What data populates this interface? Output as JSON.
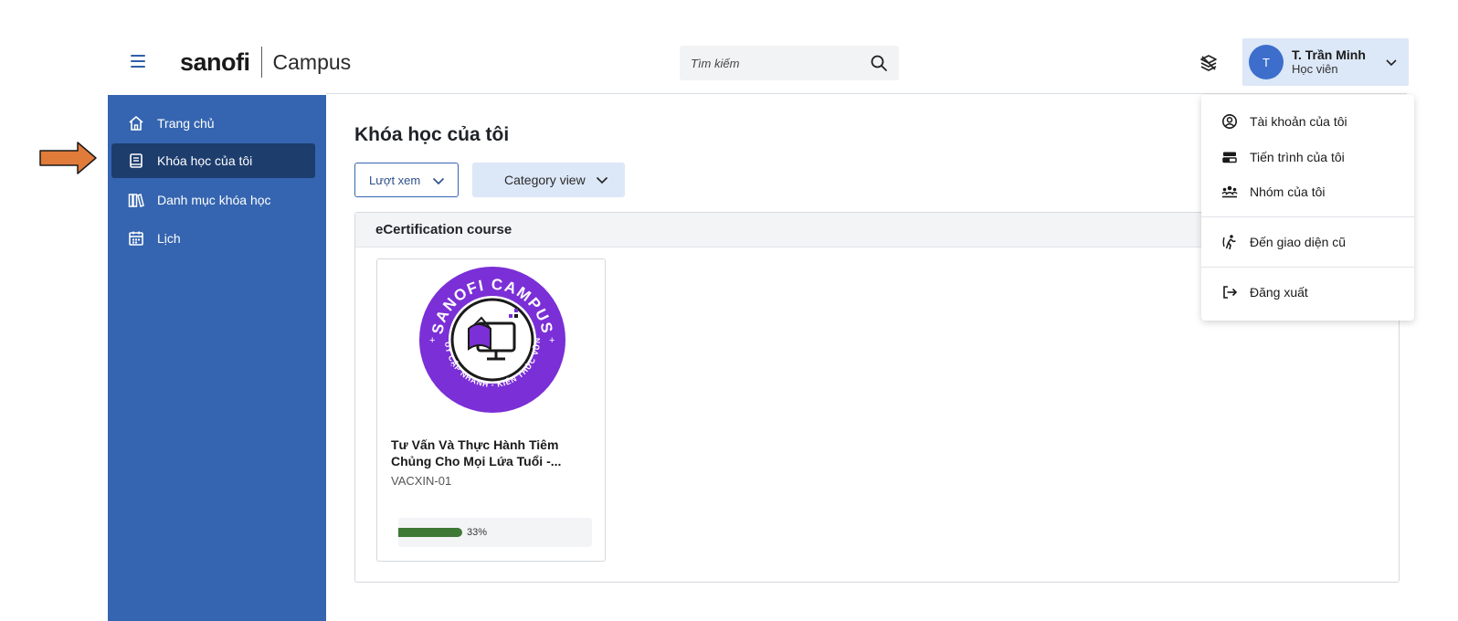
{
  "header": {
    "brand_logo": "sanofi",
    "brand_product": "Campus",
    "search_placeholder": "Tìm kiếm",
    "user": {
      "avatar_initial": "T",
      "name": "T. Trần Minh",
      "role": "Học viên"
    }
  },
  "sidebar": {
    "items": [
      {
        "label": "Trang chủ",
        "icon": "home-icon",
        "active": false
      },
      {
        "label": "Khóa học của tôi",
        "icon": "book-icon",
        "active": true
      },
      {
        "label": "Danh mục khóa học",
        "icon": "library-icon",
        "active": false
      },
      {
        "label": "Lịch",
        "icon": "calendar-icon",
        "active": false
      }
    ]
  },
  "main": {
    "title": "Khóa học của tôi",
    "views_dropdown": "Lượt xem",
    "category_dropdown": "Category view",
    "section_title": "eCertification course",
    "card": {
      "logo_text_top": "SANOFI CAMPUS",
      "logo_text_bottom": "TRUY CẬP NHANH - KIẾN THỨC VỮNG",
      "title_line1": "Tư Vấn Và Thực Hành Tiêm",
      "title_line2": "Chủng Cho Mọi Lứa Tuổi -...",
      "code": "VACXIN-01",
      "progress_percent": 33,
      "progress_label": "33%"
    }
  },
  "user_menu": {
    "items": [
      {
        "label": "Tài khoản của tôi",
        "icon": "account-icon"
      },
      {
        "label": "Tiến trình của tôi",
        "icon": "progress-icon"
      },
      {
        "label": "Nhóm của tôi",
        "icon": "group-icon"
      },
      {
        "label": "Đến giao diện cũ",
        "icon": "walk-icon"
      },
      {
        "label": "Đăng xuất",
        "icon": "logout-icon"
      }
    ]
  },
  "colors": {
    "sidebar_bg": "#3565b0",
    "sidebar_active": "#1d3d6d",
    "accent_chip": "#dce7f7",
    "progress_fill": "#3e7a36",
    "logo_purple": "#7b2fd6",
    "arrow_orange": "#e07b3a"
  }
}
